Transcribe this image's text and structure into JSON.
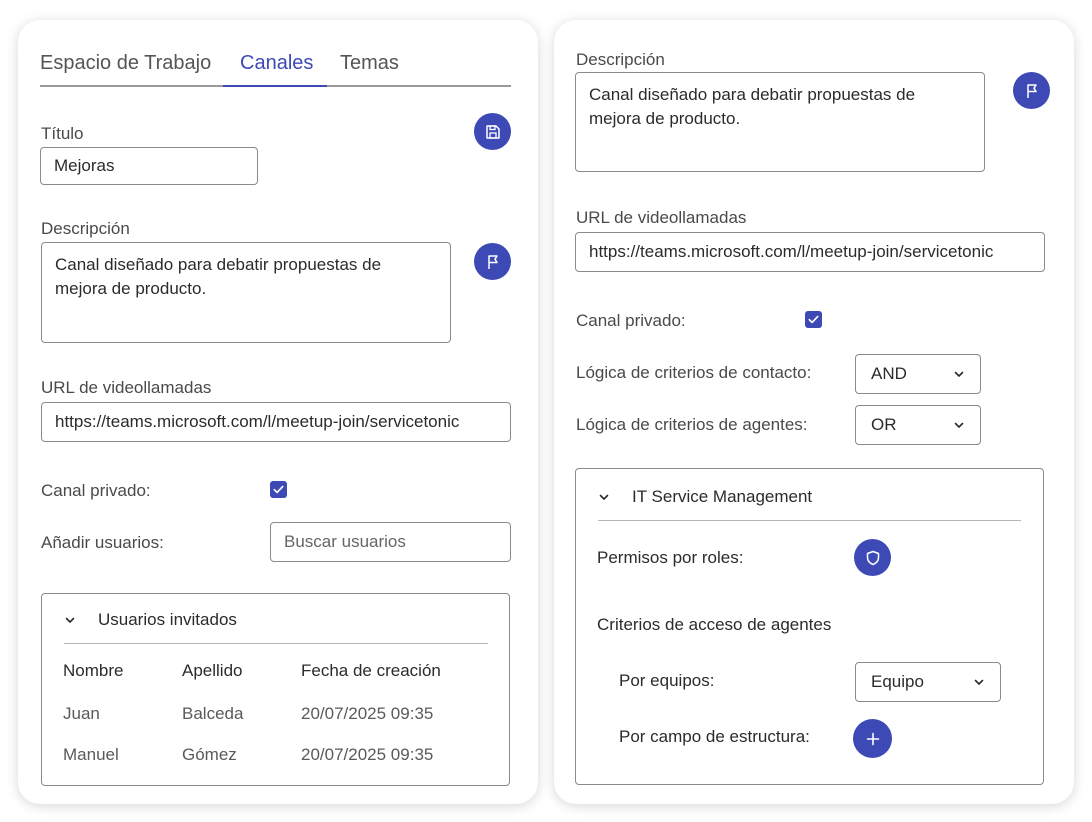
{
  "colors": {
    "accent": "#3d4ab5",
    "border": "#8a8a8a",
    "text": "#2b2b2b",
    "muted": "#5a5a5a"
  },
  "left": {
    "tabs": [
      {
        "label": "Espacio de Trabajo",
        "active": false
      },
      {
        "label": "Canales",
        "active": true
      },
      {
        "label": "Temas",
        "active": false
      }
    ],
    "title_label": "Título",
    "title_value": "Mejoras",
    "save_icon": "save-icon",
    "description_label": "Descripción",
    "description_value": "Canal diseñado para debatir propuestas de\nmejora de producto.",
    "flag_icon": "flag-icon",
    "url_label": "URL de videollamadas",
    "url_value": "https://teams.microsoft.com/l/meetup-join/servicetonic",
    "private_label": "Canal privado:",
    "private_checked": true,
    "add_users_label": "Añadir usuarios:",
    "search_placeholder": "Buscar usuarios",
    "invited": {
      "title": "Usuarios invitados",
      "columns": [
        "Nombre",
        "Apellido",
        "Fecha de creación"
      ],
      "rows": [
        [
          "Juan",
          "Balceda",
          "20/07/2025 09:35"
        ],
        [
          "Manuel",
          "Gómez",
          "20/07/2025 09:35"
        ]
      ]
    }
  },
  "right": {
    "description_label": "Descripción",
    "description_value": "Canal diseñado para debatir propuestas de\nmejora de producto.",
    "flag_icon": "flag-icon",
    "url_label": "URL de videollamadas",
    "url_value": "https://teams.microsoft.com/l/meetup-join/servicetonic",
    "private_label": "Canal privado:",
    "private_checked": true,
    "contact_logic_label": "Lógica de criterios de contacto:",
    "contact_logic_value": "AND",
    "agent_logic_label": "Lógica de criterios de agentes:",
    "agent_logic_value": "OR",
    "itsm": {
      "title": "IT Service Management",
      "role_perms_label": "Permisos por roles:",
      "shield_icon": "shield-icon",
      "agent_access_label": "Criterios de acceso de agentes",
      "by_team_label": "Por equipos:",
      "by_team_value": "Equipo",
      "by_field_label": "Por campo de estructura:",
      "plus_icon": "plus-icon"
    }
  }
}
